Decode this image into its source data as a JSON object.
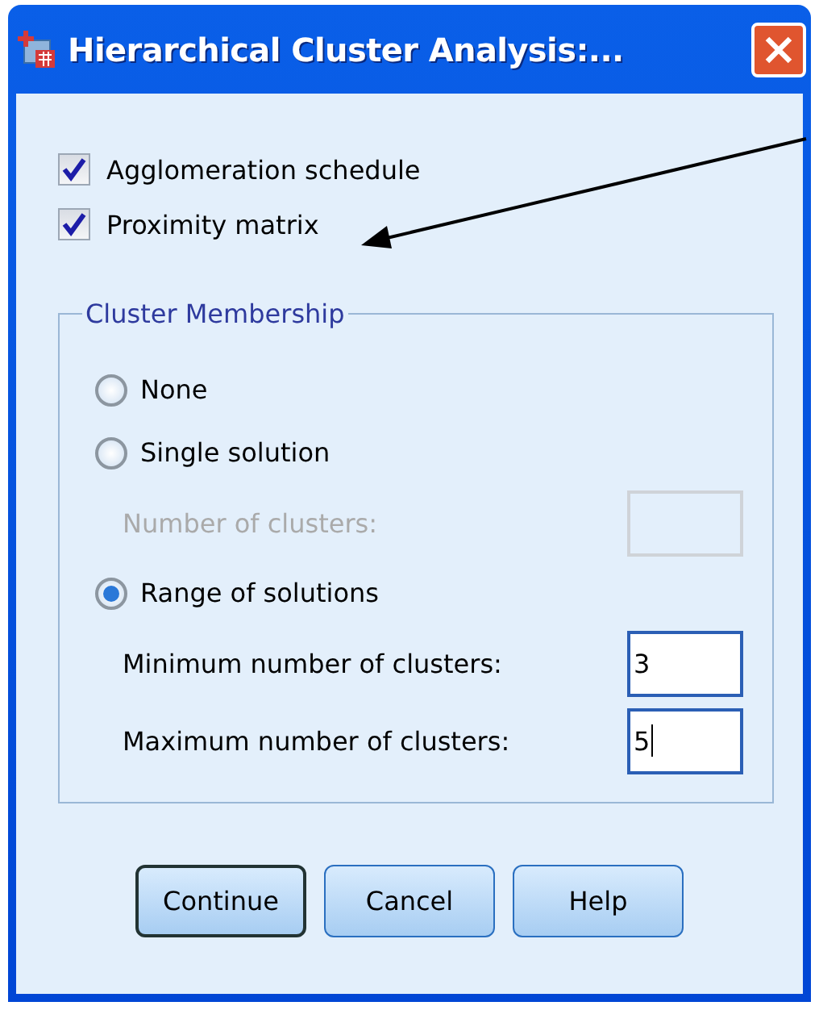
{
  "window": {
    "title": "Hierarchical Cluster Analysis:..."
  },
  "checkboxes": [
    {
      "label": "Agglomeration schedule",
      "checked": true
    },
    {
      "label": "Proximity matrix",
      "checked": true
    }
  ],
  "cluster_membership": {
    "title": "Cluster Membership",
    "items": [
      {
        "kind": "radio",
        "label": "None",
        "selected": false
      },
      {
        "kind": "radio",
        "label": "Single solution",
        "selected": false
      },
      {
        "kind": "field",
        "label": "Number of clusters:",
        "disabled": true
      },
      {
        "kind": "radio",
        "label": "Range of solutions",
        "selected": true
      },
      {
        "kind": "field",
        "label": "Minimum number of clusters:",
        "value": "3",
        "disabled": false
      },
      {
        "kind": "field",
        "label": "Maximum number of clusters:",
        "value": "5",
        "disabled": false,
        "focused": true
      }
    ]
  },
  "buttons": [
    {
      "label": "Continue",
      "default": true
    },
    {
      "label": "Cancel",
      "default": false
    },
    {
      "label": "Help",
      "default": false
    }
  ]
}
